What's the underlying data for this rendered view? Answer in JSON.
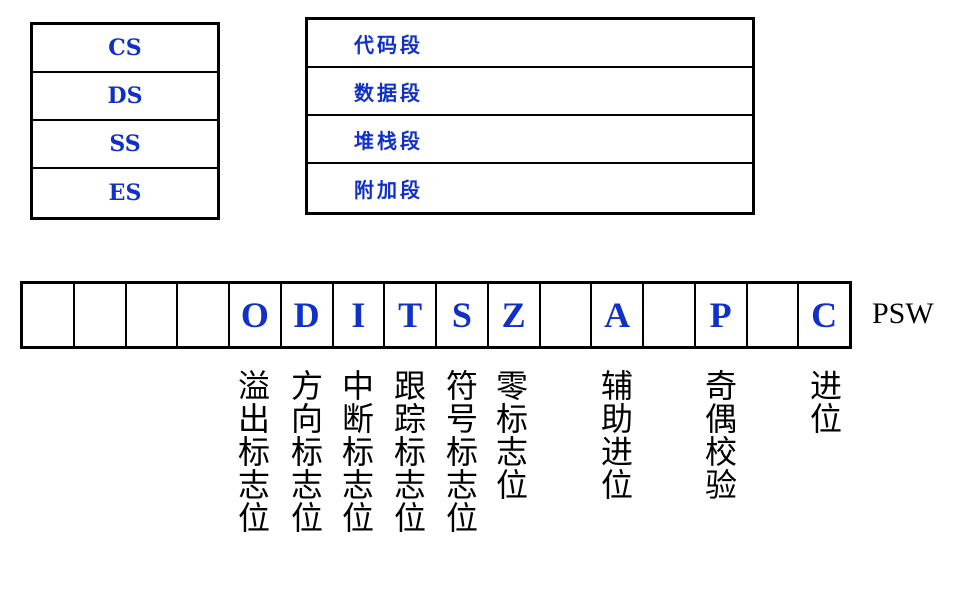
{
  "segment_registers": [
    "CS",
    "DS",
    "SS",
    "ES"
  ],
  "segments": [
    "代码段",
    "数据段",
    "堆栈段",
    "附加段"
  ],
  "flag_register": {
    "bits": [
      "",
      "",
      "",
      "",
      "O",
      "D",
      "I",
      "T",
      "S",
      "Z",
      "",
      "A",
      "",
      "P",
      "",
      "C"
    ],
    "label": "PSW"
  },
  "flag_descriptions": {
    "O": "溢出标志位",
    "D": "方向标志位",
    "I": "中断标志位",
    "T": "跟踪标志位",
    "S": "符号标志位",
    "Z": "零标志位",
    "A": "辅助进位",
    "P": "奇偶校验",
    "C": "进位"
  },
  "colors": {
    "register_text": "#1030c8",
    "border": "#000000"
  }
}
